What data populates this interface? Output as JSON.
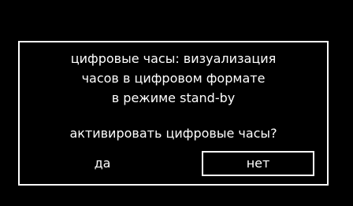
{
  "dialog": {
    "message_lines": [
      "цифровые часы: визуализация",
      "часов в цифровом формате",
      "в режиме stand-by"
    ],
    "question": "активировать цифровые часы?",
    "yes_label": "да",
    "no_label": "нет",
    "selected": "нет"
  },
  "colors": {
    "background": "#000000",
    "foreground": "#ffffff"
  }
}
